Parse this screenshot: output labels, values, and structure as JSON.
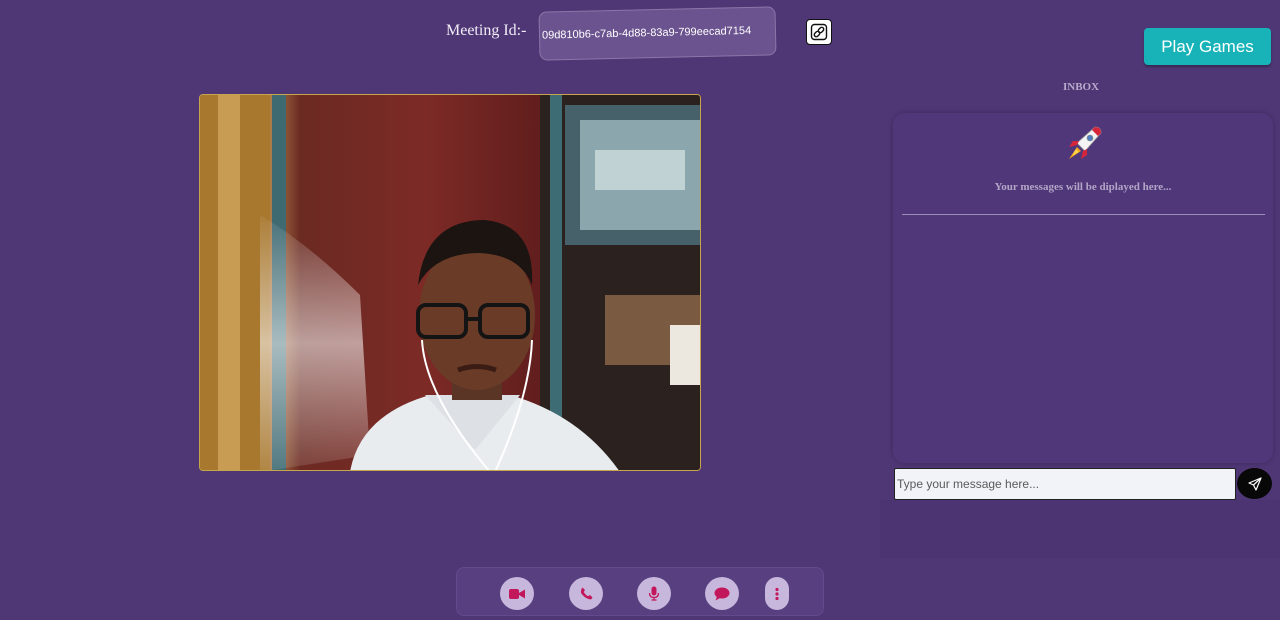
{
  "header": {
    "meeting_label": "Meeting Id:-",
    "meeting_id": "09d810b6-c7ab-4d88-83a9-799eecad7154",
    "copy_icon": "link-icon",
    "play_games_label": "Play Games"
  },
  "video": {
    "participant": "local-camera-feed"
  },
  "chat": {
    "title": "INBOX",
    "icon": "rocket-icon",
    "empty_text": "Your messages will be diplayed here...",
    "input_placeholder": "Type your message here...",
    "send_icon": "paper-plane-icon"
  },
  "controls": [
    {
      "name": "video-toggle",
      "icon": "video-camera-icon"
    },
    {
      "name": "end-call",
      "icon": "phone-icon"
    },
    {
      "name": "mic-toggle",
      "icon": "microphone-icon"
    },
    {
      "name": "chat-toggle",
      "icon": "chat-bubble-icon"
    },
    {
      "name": "more-options",
      "icon": "vertical-dots-icon"
    }
  ],
  "colors": {
    "background": "#4f3776",
    "accent": "#17b3b8",
    "control_icon": "#c2185b",
    "control_bg": "#c8b7dc"
  }
}
